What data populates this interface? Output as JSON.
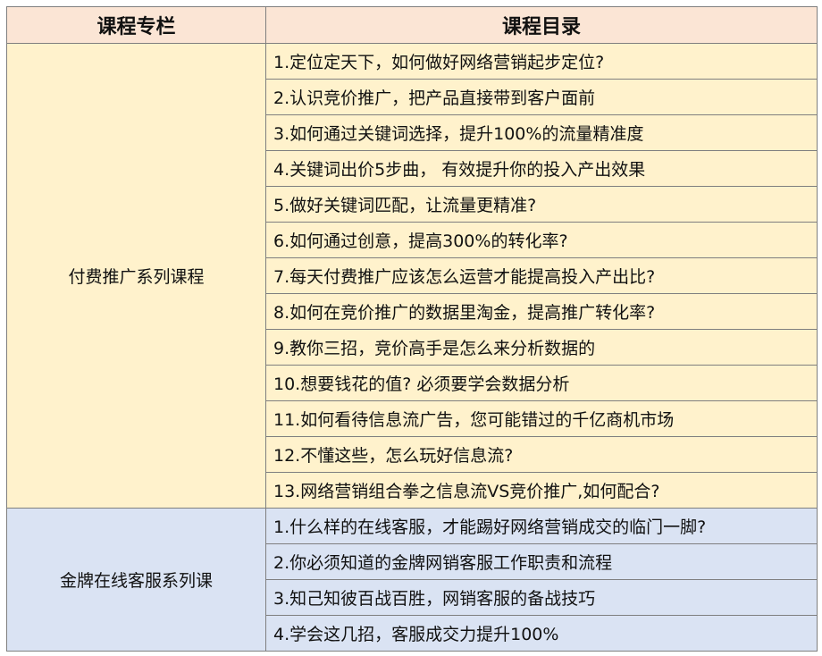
{
  "header": {
    "column_1": "课程专栏",
    "column_2": "课程目录"
  },
  "sections": [
    {
      "name": "付费推广系列课程",
      "color": "#fff2cc",
      "items": [
        "1.定位定天下，如何做好网络营销起步定位?",
        "2.认识竞价推广，把产品直接带到客户面前",
        "3.如何通过关键词选择，提升100%的流量精准度",
        "4.关键词出价5步曲， 有效提升你的投入产出效果",
        "5.做好关键词匹配，让流量更精准?",
        "6.如何通过创意，提高300%的转化率?",
        "7.每天付费推广应该怎么运营才能提高投入产出比?",
        "8.如何在竞价推广的数据里淘金，提高推广转化率?",
        "9.教你三招，竞价高手是怎么来分析数据的",
        "10.想要钱花的值? 必须要学会数据分析",
        "11.如何看待信息流广告，您可能错过的千亿商机市场",
        "12.不懂这些，怎么玩好信息流?",
        "13.网络营销组合拳之信息流VS竞价推广,如何配合?"
      ]
    },
    {
      "name": "金牌在线客服系列课",
      "color": "#dae3f3",
      "items": [
        "1.什么样的在线客服，才能踢好网络营销成交的临门一脚?",
        "2.你必须知道的金牌网销客服工作职责和流程",
        "3.知己知彼百战百胜，网销客服的备战技巧",
        "4.学会这几招，客服成交力提升100%"
      ]
    }
  ],
  "colors": {
    "header_bg": "#fbe5d5",
    "border": "#7f7f7f"
  }
}
